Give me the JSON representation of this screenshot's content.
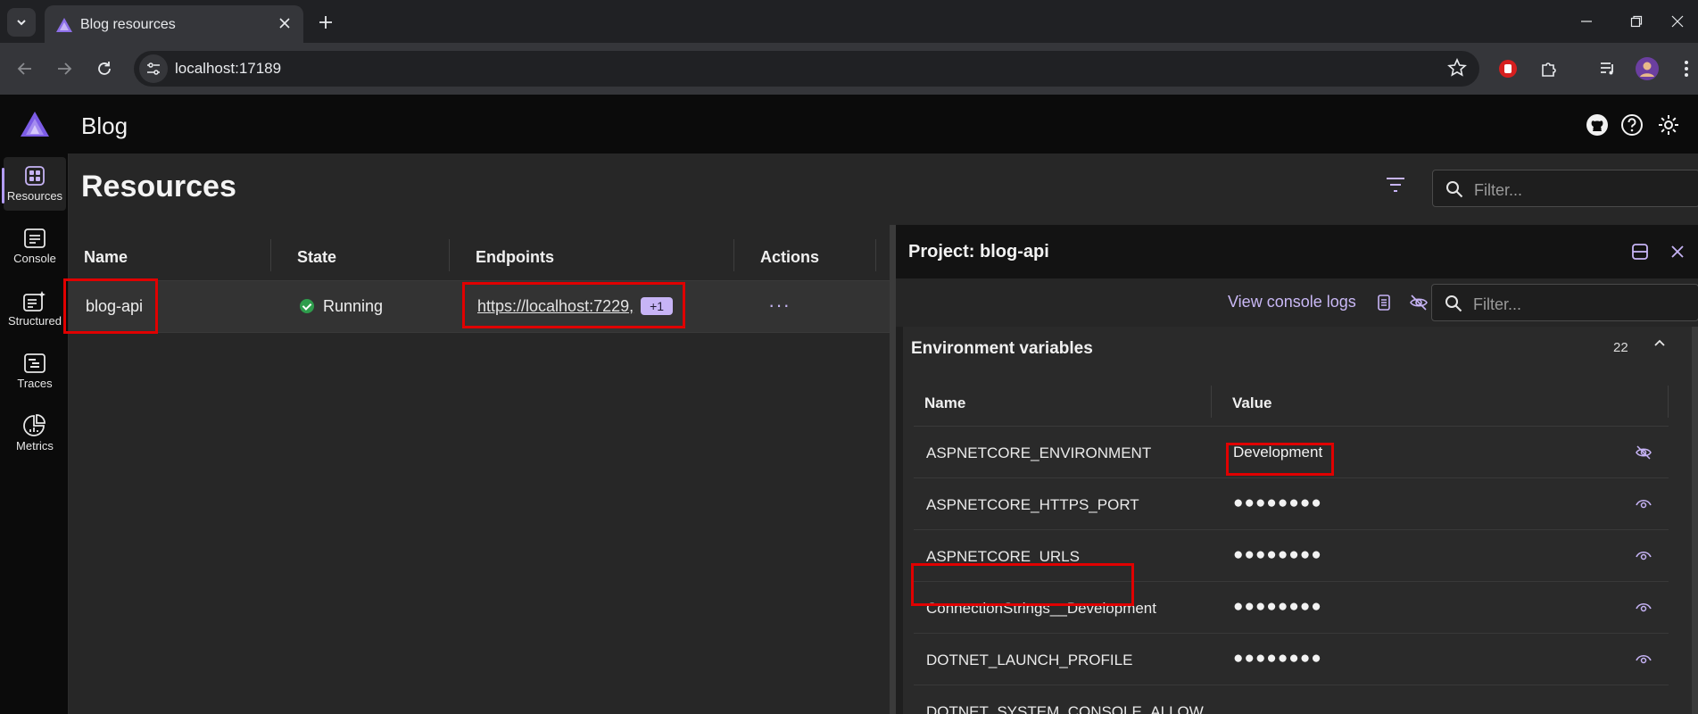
{
  "browser": {
    "tab_title": "Blog resources",
    "url": "localhost:17189"
  },
  "app": {
    "title": "Blog",
    "nav": [
      {
        "label": "Resources",
        "icon": "resources-icon",
        "active": true
      },
      {
        "label": "Console",
        "icon": "console-icon"
      },
      {
        "label": "Structured",
        "icon": "structured-icon"
      },
      {
        "label": "Traces",
        "icon": "traces-icon"
      },
      {
        "label": "Metrics",
        "icon": "metrics-icon"
      }
    ]
  },
  "resources": {
    "title": "Resources",
    "filter_placeholder": "Filter...",
    "columns": [
      "Name",
      "State",
      "Endpoints",
      "Actions"
    ],
    "rows": [
      {
        "name": "blog-api",
        "state": "Running",
        "endpoint": "https://localhost:7229,",
        "endpoint_more": "+1",
        "actions": "···"
      }
    ]
  },
  "details": {
    "title": "Project: blog-api",
    "view_console_logs": "View console logs",
    "filter_placeholder": "Filter...",
    "env": {
      "title": "Environment variables",
      "count": "22",
      "columns": [
        "Name",
        "Value"
      ],
      "rows": [
        {
          "name": "ASPNETCORE_ENVIRONMENT",
          "value": "Development"
        },
        {
          "name": "ASPNETCORE_HTTPS_PORT",
          "value": "●●●●●●●●"
        },
        {
          "name": "ASPNETCORE_URLS",
          "value": "●●●●●●●●"
        },
        {
          "name": "ConnectionStrings__Development",
          "value": "●●●●●●●●"
        },
        {
          "name": "DOTNET_LAUNCH_PROFILE",
          "value": "●●●●●●●●"
        },
        {
          "name": "DOTNET_SYSTEM_CONSOLE_ALLOW",
          "value": ""
        }
      ]
    }
  },
  "colors": {
    "accent": "#c7b4f6",
    "highlight": "#e00000",
    "running": "#2e9d4c"
  }
}
